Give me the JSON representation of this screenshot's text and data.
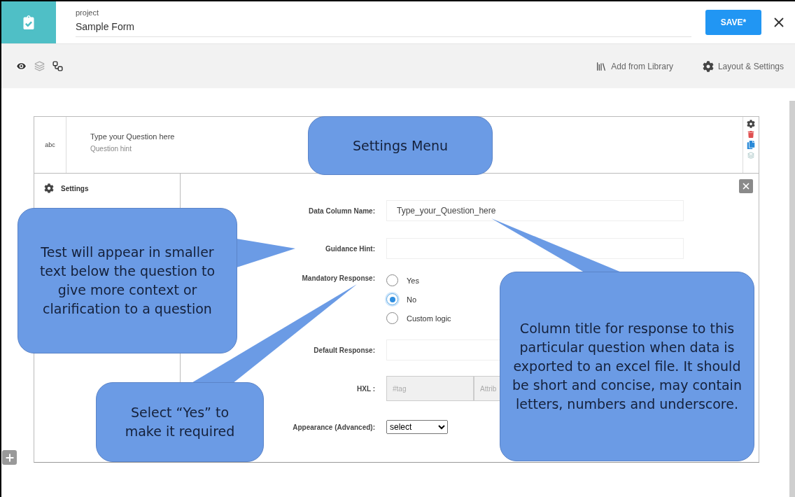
{
  "header": {
    "label": "project",
    "title": "Sample Form",
    "save_button": "SAVE*"
  },
  "toolbar": {
    "actions": [
      {
        "kind": "library",
        "label": "Add from Library"
      },
      {
        "kind": "settings",
        "label": "Layout & Settings"
      }
    ]
  },
  "question": {
    "type_label": "abc",
    "title": "Type your Question here",
    "hint": "Question hint"
  },
  "settings": {
    "heading": "Settings",
    "fields": [
      {
        "kind": "text",
        "label": "Data Column Name:",
        "value": "Type_your_Question_here"
      },
      {
        "kind": "text",
        "label": "Guidance Hint:"
      },
      {
        "kind": "radio",
        "label": "Mandatory Response:",
        "options": [
          {
            "label": "Yes",
            "selected": false
          },
          {
            "label": "No",
            "selected": true
          },
          {
            "label": "Custom logic",
            "selected": false
          }
        ]
      },
      {
        "kind": "text",
        "label": "Default Response:"
      },
      {
        "kind": "hxl",
        "label": "HXL :",
        "placeholders": [
          "#tag",
          "Attrib"
        ]
      },
      {
        "kind": "select",
        "label": "Appearance (Advanced):",
        "value": "select"
      }
    ]
  },
  "callouts": [
    {
      "text": "Settings Menu"
    },
    {
      "text": "Test will appear in smaller text below the question to give more context or clarification to a question"
    },
    {
      "text": "Select “Yes” to make it required"
    },
    {
      "text": "Column title for response to this particular question when data is exported to an excel file. It should be short and concise, may contain letters, numbers and underscore."
    }
  ]
}
